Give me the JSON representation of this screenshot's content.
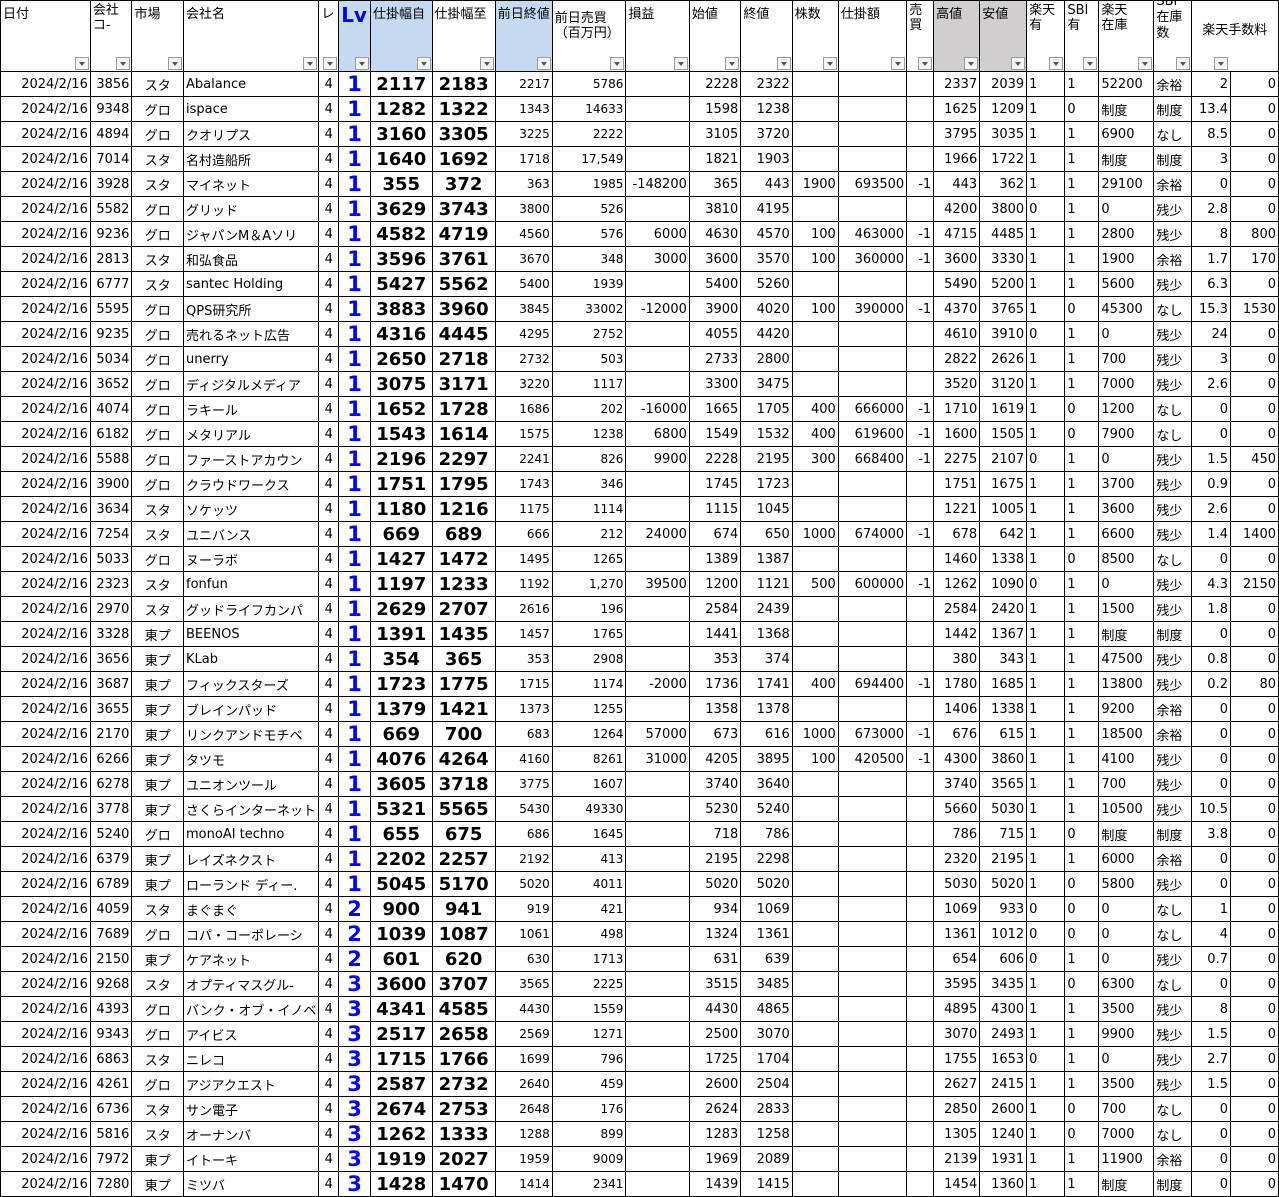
{
  "headers": {
    "date": "日付",
    "code_line1": "会社",
    "code_line2": "コ-",
    "market": "市場",
    "name": "会社名",
    "lev": "レ",
    "lv": "Lv",
    "from": "仕掛幅自",
    "to": "仕掛幅至",
    "prev_close": "前日終値",
    "prev_vol_line1": "前日売買",
    "prev_vol_line2": "（百万円）",
    "pnl": "損益",
    "open": "始値",
    "close": "終値",
    "shares": "株数",
    "amount": "仕掛額",
    "side_line1": "売",
    "side_line2": "買",
    "high": "高値",
    "low": "安値",
    "rakuten_line1": "楽天",
    "rakuten_line2": "有",
    "sbi_line1": "SBI",
    "sbi_line2": "有",
    "rstock_line1": "楽天",
    "rstock_line2": "在庫",
    "sbistock_line1": "SBI",
    "sbistock_line2": "在庫",
    "sbistock_line3": "数",
    "fee": "楽天手数料"
  },
  "rows": [
    [
      "2024/2/16",
      "3856",
      "スタ",
      "Abalance",
      "4",
      "1",
      "2117",
      "2183",
      "2217",
      "5786",
      "",
      "2228",
      "2322",
      "",
      "",
      "",
      "2337",
      "2039",
      "1",
      "1",
      "52200",
      "余裕",
      "2",
      "0"
    ],
    [
      "2024/2/16",
      "9348",
      "グロ",
      "ispace",
      "4",
      "1",
      "1282",
      "1322",
      "1343",
      "14633",
      "",
      "1598",
      "1238",
      "",
      "",
      "",
      "1625",
      "1209",
      "1",
      "0",
      "制度",
      "制度",
      "13.4",
      "0"
    ],
    [
      "2024/2/16",
      "4894",
      "グロ",
      "クオリプス",
      "4",
      "1",
      "3160",
      "3305",
      "3225",
      "2222",
      "",
      "3105",
      "3720",
      "",
      "",
      "",
      "3795",
      "3035",
      "1",
      "1",
      "6900",
      "なし",
      "8.5",
      "0"
    ],
    [
      "2024/2/16",
      "7014",
      "スタ",
      "名村造船所",
      "4",
      "1",
      "1640",
      "1692",
      "1718",
      "17,549",
      "",
      "1821",
      "1903",
      "",
      "",
      "",
      "1966",
      "1722",
      "1",
      "1",
      "制度",
      "制度",
      "3",
      "0"
    ],
    [
      "2024/2/16",
      "3928",
      "スタ",
      "マイネット",
      "4",
      "1",
      "355",
      "372",
      "363",
      "1985",
      "-148200",
      "365",
      "443",
      "1900",
      "693500",
      "-1",
      "443",
      "362",
      "1",
      "1",
      "29100",
      "余裕",
      "0",
      "0"
    ],
    [
      "2024/2/16",
      "5582",
      "グロ",
      "グリッド",
      "4",
      "1",
      "3629",
      "3743",
      "3800",
      "526",
      "",
      "3810",
      "4195",
      "",
      "",
      "",
      "4200",
      "3800",
      "0",
      "1",
      "0",
      "残少",
      "2.8",
      "0"
    ],
    [
      "2024/2/16",
      "9236",
      "グロ",
      "ジャパンM＆Aソリ",
      "4",
      "1",
      "4582",
      "4719",
      "4560",
      "576",
      "6000",
      "4630",
      "4570",
      "100",
      "463000",
      "-1",
      "4715",
      "4485",
      "1",
      "1",
      "2800",
      "残少",
      "8",
      "800"
    ],
    [
      "2024/2/16",
      "2813",
      "スタ",
      "和弘食品",
      "4",
      "1",
      "3596",
      "3761",
      "3670",
      "348",
      "3000",
      "3600",
      "3570",
      "100",
      "360000",
      "-1",
      "3600",
      "3330",
      "1",
      "1",
      "1900",
      "余裕",
      "1.7",
      "170"
    ],
    [
      "2024/2/16",
      "6777",
      "スタ",
      "santec Holding",
      "4",
      "1",
      "5427",
      "5562",
      "5400",
      "1939",
      "",
      "5400",
      "5260",
      "",
      "",
      "",
      "5490",
      "5200",
      "1",
      "1",
      "5600",
      "残少",
      "6.3",
      "0"
    ],
    [
      "2024/2/16",
      "5595",
      "グロ",
      "QPS研究所",
      "4",
      "1",
      "3883",
      "3960",
      "3845",
      "33002",
      "-12000",
      "3900",
      "4020",
      "100",
      "390000",
      "-1",
      "4370",
      "3765",
      "1",
      "0",
      "45300",
      "なし",
      "15.3",
      "1530"
    ],
    [
      "2024/2/16",
      "9235",
      "グロ",
      "売れるネット広告",
      "4",
      "1",
      "4316",
      "4445",
      "4295",
      "2752",
      "",
      "4055",
      "4420",
      "",
      "",
      "",
      "4610",
      "3910",
      "0",
      "1",
      "0",
      "残少",
      "24",
      "0"
    ],
    [
      "2024/2/16",
      "5034",
      "グロ",
      "unerry",
      "4",
      "1",
      "2650",
      "2718",
      "2732",
      "503",
      "",
      "2733",
      "2800",
      "",
      "",
      "",
      "2822",
      "2626",
      "1",
      "1",
      "700",
      "残少",
      "3",
      "0"
    ],
    [
      "2024/2/16",
      "3652",
      "グロ",
      "ディジタルメディア",
      "4",
      "1",
      "3075",
      "3171",
      "3220",
      "1117",
      "",
      "3300",
      "3475",
      "",
      "",
      "",
      "3520",
      "3120",
      "1",
      "1",
      "7000",
      "残少",
      "2.6",
      "0"
    ],
    [
      "2024/2/16",
      "4074",
      "グロ",
      "ラキール",
      "4",
      "1",
      "1652",
      "1728",
      "1686",
      "202",
      "-16000",
      "1665",
      "1705",
      "400",
      "666000",
      "-1",
      "1710",
      "1619",
      "1",
      "0",
      "1200",
      "なし",
      "0",
      "0"
    ],
    [
      "2024/2/16",
      "6182",
      "グロ",
      "メタリアル",
      "4",
      "1",
      "1543",
      "1614",
      "1575",
      "1238",
      "6800",
      "1549",
      "1532",
      "400",
      "619600",
      "-1",
      "1600",
      "1505",
      "1",
      "0",
      "7900",
      "なし",
      "0",
      "0"
    ],
    [
      "2024/2/16",
      "5588",
      "グロ",
      "ファーストアカウン",
      "4",
      "1",
      "2196",
      "2297",
      "2241",
      "826",
      "9900",
      "2228",
      "2195",
      "300",
      "668400",
      "-1",
      "2275",
      "2107",
      "0",
      "1",
      "0",
      "残少",
      "1.5",
      "450"
    ],
    [
      "2024/2/16",
      "3900",
      "グロ",
      "クラウドワークス",
      "4",
      "1",
      "1751",
      "1795",
      "1743",
      "346",
      "",
      "1745",
      "1723",
      "",
      "",
      "",
      "1751",
      "1675",
      "1",
      "1",
      "3700",
      "残少",
      "0.9",
      "0"
    ],
    [
      "2024/2/16",
      "3634",
      "スタ",
      "ソケッツ",
      "4",
      "1",
      "1180",
      "1216",
      "1175",
      "1114",
      "",
      "1115",
      "1045",
      "",
      "",
      "",
      "1221",
      "1005",
      "1",
      "1",
      "3600",
      "残少",
      "2.6",
      "0"
    ],
    [
      "2024/2/16",
      "7254",
      "スタ",
      "ユニバンス",
      "4",
      "1",
      "669",
      "689",
      "666",
      "212",
      "24000",
      "674",
      "650",
      "1000",
      "674000",
      "-1",
      "678",
      "642",
      "1",
      "1",
      "6600",
      "残少",
      "1.4",
      "1400"
    ],
    [
      "2024/2/16",
      "5033",
      "グロ",
      "ヌーラボ",
      "4",
      "1",
      "1427",
      "1472",
      "1495",
      "1265",
      "",
      "1389",
      "1387",
      "",
      "",
      "",
      "1460",
      "1338",
      "1",
      "0",
      "8500",
      "なし",
      "0",
      "0"
    ],
    [
      "2024/2/16",
      "2323",
      "スタ",
      "fonfun",
      "4",
      "1",
      "1197",
      "1233",
      "1192",
      "1,270",
      "39500",
      "1200",
      "1121",
      "500",
      "600000",
      "-1",
      "1262",
      "1090",
      "0",
      "1",
      "0",
      "残少",
      "4.3",
      "2150"
    ],
    [
      "2024/2/16",
      "2970",
      "スタ",
      "グッドライフカンパ",
      "4",
      "1",
      "2629",
      "2707",
      "2616",
      "196",
      "",
      "2584",
      "2439",
      "",
      "",
      "",
      "2584",
      "2420",
      "1",
      "1",
      "1500",
      "残少",
      "1.8",
      "0"
    ],
    [
      "2024/2/16",
      "3328",
      "東プ",
      "BEENOS",
      "4",
      "1",
      "1391",
      "1435",
      "1457",
      "1765",
      "",
      "1441",
      "1368",
      "",
      "",
      "",
      "1442",
      "1367",
      "1",
      "1",
      "制度",
      "制度",
      "0",
      "0"
    ],
    [
      "2024/2/16",
      "3656",
      "東プ",
      "KLab",
      "4",
      "1",
      "354",
      "365",
      "353",
      "2908",
      "",
      "353",
      "374",
      "",
      "",
      "",
      "380",
      "343",
      "1",
      "1",
      "47500",
      "残少",
      "0.8",
      "0"
    ],
    [
      "2024/2/16",
      "3687",
      "東プ",
      "フィックスターズ",
      "4",
      "1",
      "1723",
      "1775",
      "1715",
      "1174",
      "-2000",
      "1736",
      "1741",
      "400",
      "694400",
      "-1",
      "1780",
      "1685",
      "1",
      "1",
      "13800",
      "残少",
      "0.2",
      "80"
    ],
    [
      "2024/2/16",
      "3655",
      "東プ",
      "ブレインパッド",
      "4",
      "1",
      "1379",
      "1421",
      "1373",
      "1255",
      "",
      "1358",
      "1378",
      "",
      "",
      "",
      "1406",
      "1338",
      "1",
      "1",
      "9200",
      "余裕",
      "0",
      "0"
    ],
    [
      "2024/2/16",
      "2170",
      "東プ",
      "リンクアンドモチベ",
      "4",
      "1",
      "669",
      "700",
      "683",
      "1264",
      "57000",
      "673",
      "616",
      "1000",
      "673000",
      "-1",
      "676",
      "615",
      "1",
      "1",
      "18500",
      "余裕",
      "0",
      "0"
    ],
    [
      "2024/2/16",
      "6266",
      "東プ",
      "タツモ",
      "4",
      "1",
      "4076",
      "4264",
      "4160",
      "8261",
      "31000",
      "4205",
      "3895",
      "100",
      "420500",
      "-1",
      "4300",
      "3860",
      "1",
      "1",
      "4100",
      "残少",
      "0",
      "0"
    ],
    [
      "2024/2/16",
      "6278",
      "東プ",
      "ユニオンツール",
      "4",
      "1",
      "3605",
      "3718",
      "3775",
      "1607",
      "",
      "3740",
      "3640",
      "",
      "",
      "",
      "3740",
      "3565",
      "1",
      "1",
      "700",
      "残少",
      "0",
      "0"
    ],
    [
      "2024/2/16",
      "3778",
      "東プ",
      "さくらインターネット",
      "4",
      "1",
      "5321",
      "5565",
      "5430",
      "49330",
      "",
      "5230",
      "5240",
      "",
      "",
      "",
      "5660",
      "5030",
      "1",
      "1",
      "10500",
      "残少",
      "10.5",
      "0"
    ],
    [
      "2024/2/16",
      "5240",
      "グロ",
      "monoAI techno",
      "4",
      "1",
      "655",
      "675",
      "686",
      "1645",
      "",
      "718",
      "786",
      "",
      "",
      "",
      "786",
      "715",
      "1",
      "0",
      "制度",
      "制度",
      "3.8",
      "0"
    ],
    [
      "2024/2/16",
      "6379",
      "東プ",
      "レイズネクスト",
      "4",
      "1",
      "2202",
      "2257",
      "2192",
      "413",
      "",
      "2195",
      "2298",
      "",
      "",
      "",
      "2320",
      "2195",
      "1",
      "1",
      "6000",
      "余裕",
      "0",
      "0"
    ],
    [
      "2024/2/16",
      "6789",
      "東プ",
      "ローランド ディー.",
      "4",
      "1",
      "5045",
      "5170",
      "5020",
      "4011",
      "",
      "5020",
      "5020",
      "",
      "",
      "",
      "5030",
      "5020",
      "1",
      "0",
      "5800",
      "残少",
      "0",
      "0"
    ],
    [
      "2024/2/16",
      "4059",
      "スタ",
      "まぐまぐ",
      "4",
      "2",
      "900",
      "941",
      "919",
      "421",
      "",
      "934",
      "1069",
      "",
      "",
      "",
      "1069",
      "933",
      "0",
      "0",
      "0",
      "なし",
      "1",
      "0"
    ],
    [
      "2024/2/16",
      "7689",
      "グロ",
      "コパ・コーポレーシ",
      "4",
      "2",
      "1039",
      "1087",
      "1061",
      "498",
      "",
      "1324",
      "1361",
      "",
      "",
      "",
      "1361",
      "1012",
      "0",
      "0",
      "0",
      "なし",
      "4",
      "0"
    ],
    [
      "2024/2/16",
      "2150",
      "東プ",
      "ケアネット",
      "4",
      "2",
      "601",
      "620",
      "630",
      "1713",
      "",
      "631",
      "639",
      "",
      "",
      "",
      "654",
      "606",
      "0",
      "1",
      "0",
      "残少",
      "0.7",
      "0"
    ],
    [
      "2024/2/16",
      "9268",
      "スタ",
      "オプティマスグル-",
      "4",
      "3",
      "3600",
      "3707",
      "3565",
      "2225",
      "",
      "3515",
      "3485",
      "",
      "",
      "",
      "3595",
      "3435",
      "1",
      "0",
      "6300",
      "なし",
      "0",
      "0"
    ],
    [
      "2024/2/16",
      "4393",
      "グロ",
      "バンク・オブ・イノベ",
      "4",
      "3",
      "4341",
      "4585",
      "4430",
      "1559",
      "",
      "4430",
      "4865",
      "",
      "",
      "",
      "4895",
      "4300",
      "1",
      "1",
      "3500",
      "残少",
      "8",
      "0"
    ],
    [
      "2024/2/16",
      "9343",
      "グロ",
      "アイビス",
      "4",
      "3",
      "2517",
      "2658",
      "2569",
      "1271",
      "",
      "2500",
      "3070",
      "",
      "",
      "",
      "3070",
      "2493",
      "1",
      "1",
      "9900",
      "残少",
      "1.5",
      "0"
    ],
    [
      "2024/2/16",
      "6863",
      "スタ",
      "ニレコ",
      "4",
      "3",
      "1715",
      "1766",
      "1699",
      "796",
      "",
      "1725",
      "1704",
      "",
      "",
      "",
      "1755",
      "1653",
      "0",
      "1",
      "0",
      "残少",
      "2.7",
      "0"
    ],
    [
      "2024/2/16",
      "4261",
      "グロ",
      "アジアクエスト",
      "4",
      "3",
      "2587",
      "2732",
      "2640",
      "459",
      "",
      "2600",
      "2504",
      "",
      "",
      "",
      "2627",
      "2415",
      "1",
      "1",
      "3500",
      "残少",
      "1.5",
      "0"
    ],
    [
      "2024/2/16",
      "6736",
      "スタ",
      "サン電子",
      "4",
      "3",
      "2674",
      "2753",
      "2648",
      "176",
      "",
      "2624",
      "2833",
      "",
      "",
      "",
      "2850",
      "2600",
      "1",
      "0",
      "700",
      "なし",
      "0",
      "0"
    ],
    [
      "2024/2/16",
      "5816",
      "スタ",
      "オーナンバ",
      "4",
      "3",
      "1262",
      "1333",
      "1288",
      "899",
      "",
      "1283",
      "1258",
      "",
      "",
      "",
      "1305",
      "1240",
      "1",
      "0",
      "7000",
      "なし",
      "0",
      "0"
    ],
    [
      "2024/2/16",
      "7972",
      "東プ",
      "イトーキ",
      "4",
      "3",
      "1919",
      "2027",
      "1959",
      "9009",
      "",
      "1969",
      "2089",
      "",
      "",
      "",
      "2139",
      "1931",
      "1",
      "1",
      "11900",
      "余裕",
      "0",
      "0"
    ],
    [
      "2024/2/16",
      "7280",
      "東プ",
      "ミツバ",
      "4",
      "3",
      "1428",
      "1470",
      "1414",
      "2341",
      "",
      "1439",
      "1415",
      "",
      "",
      "",
      "1454",
      "1360",
      "1",
      "1",
      "制度",
      "制度",
      "0",
      "0"
    ]
  ]
}
